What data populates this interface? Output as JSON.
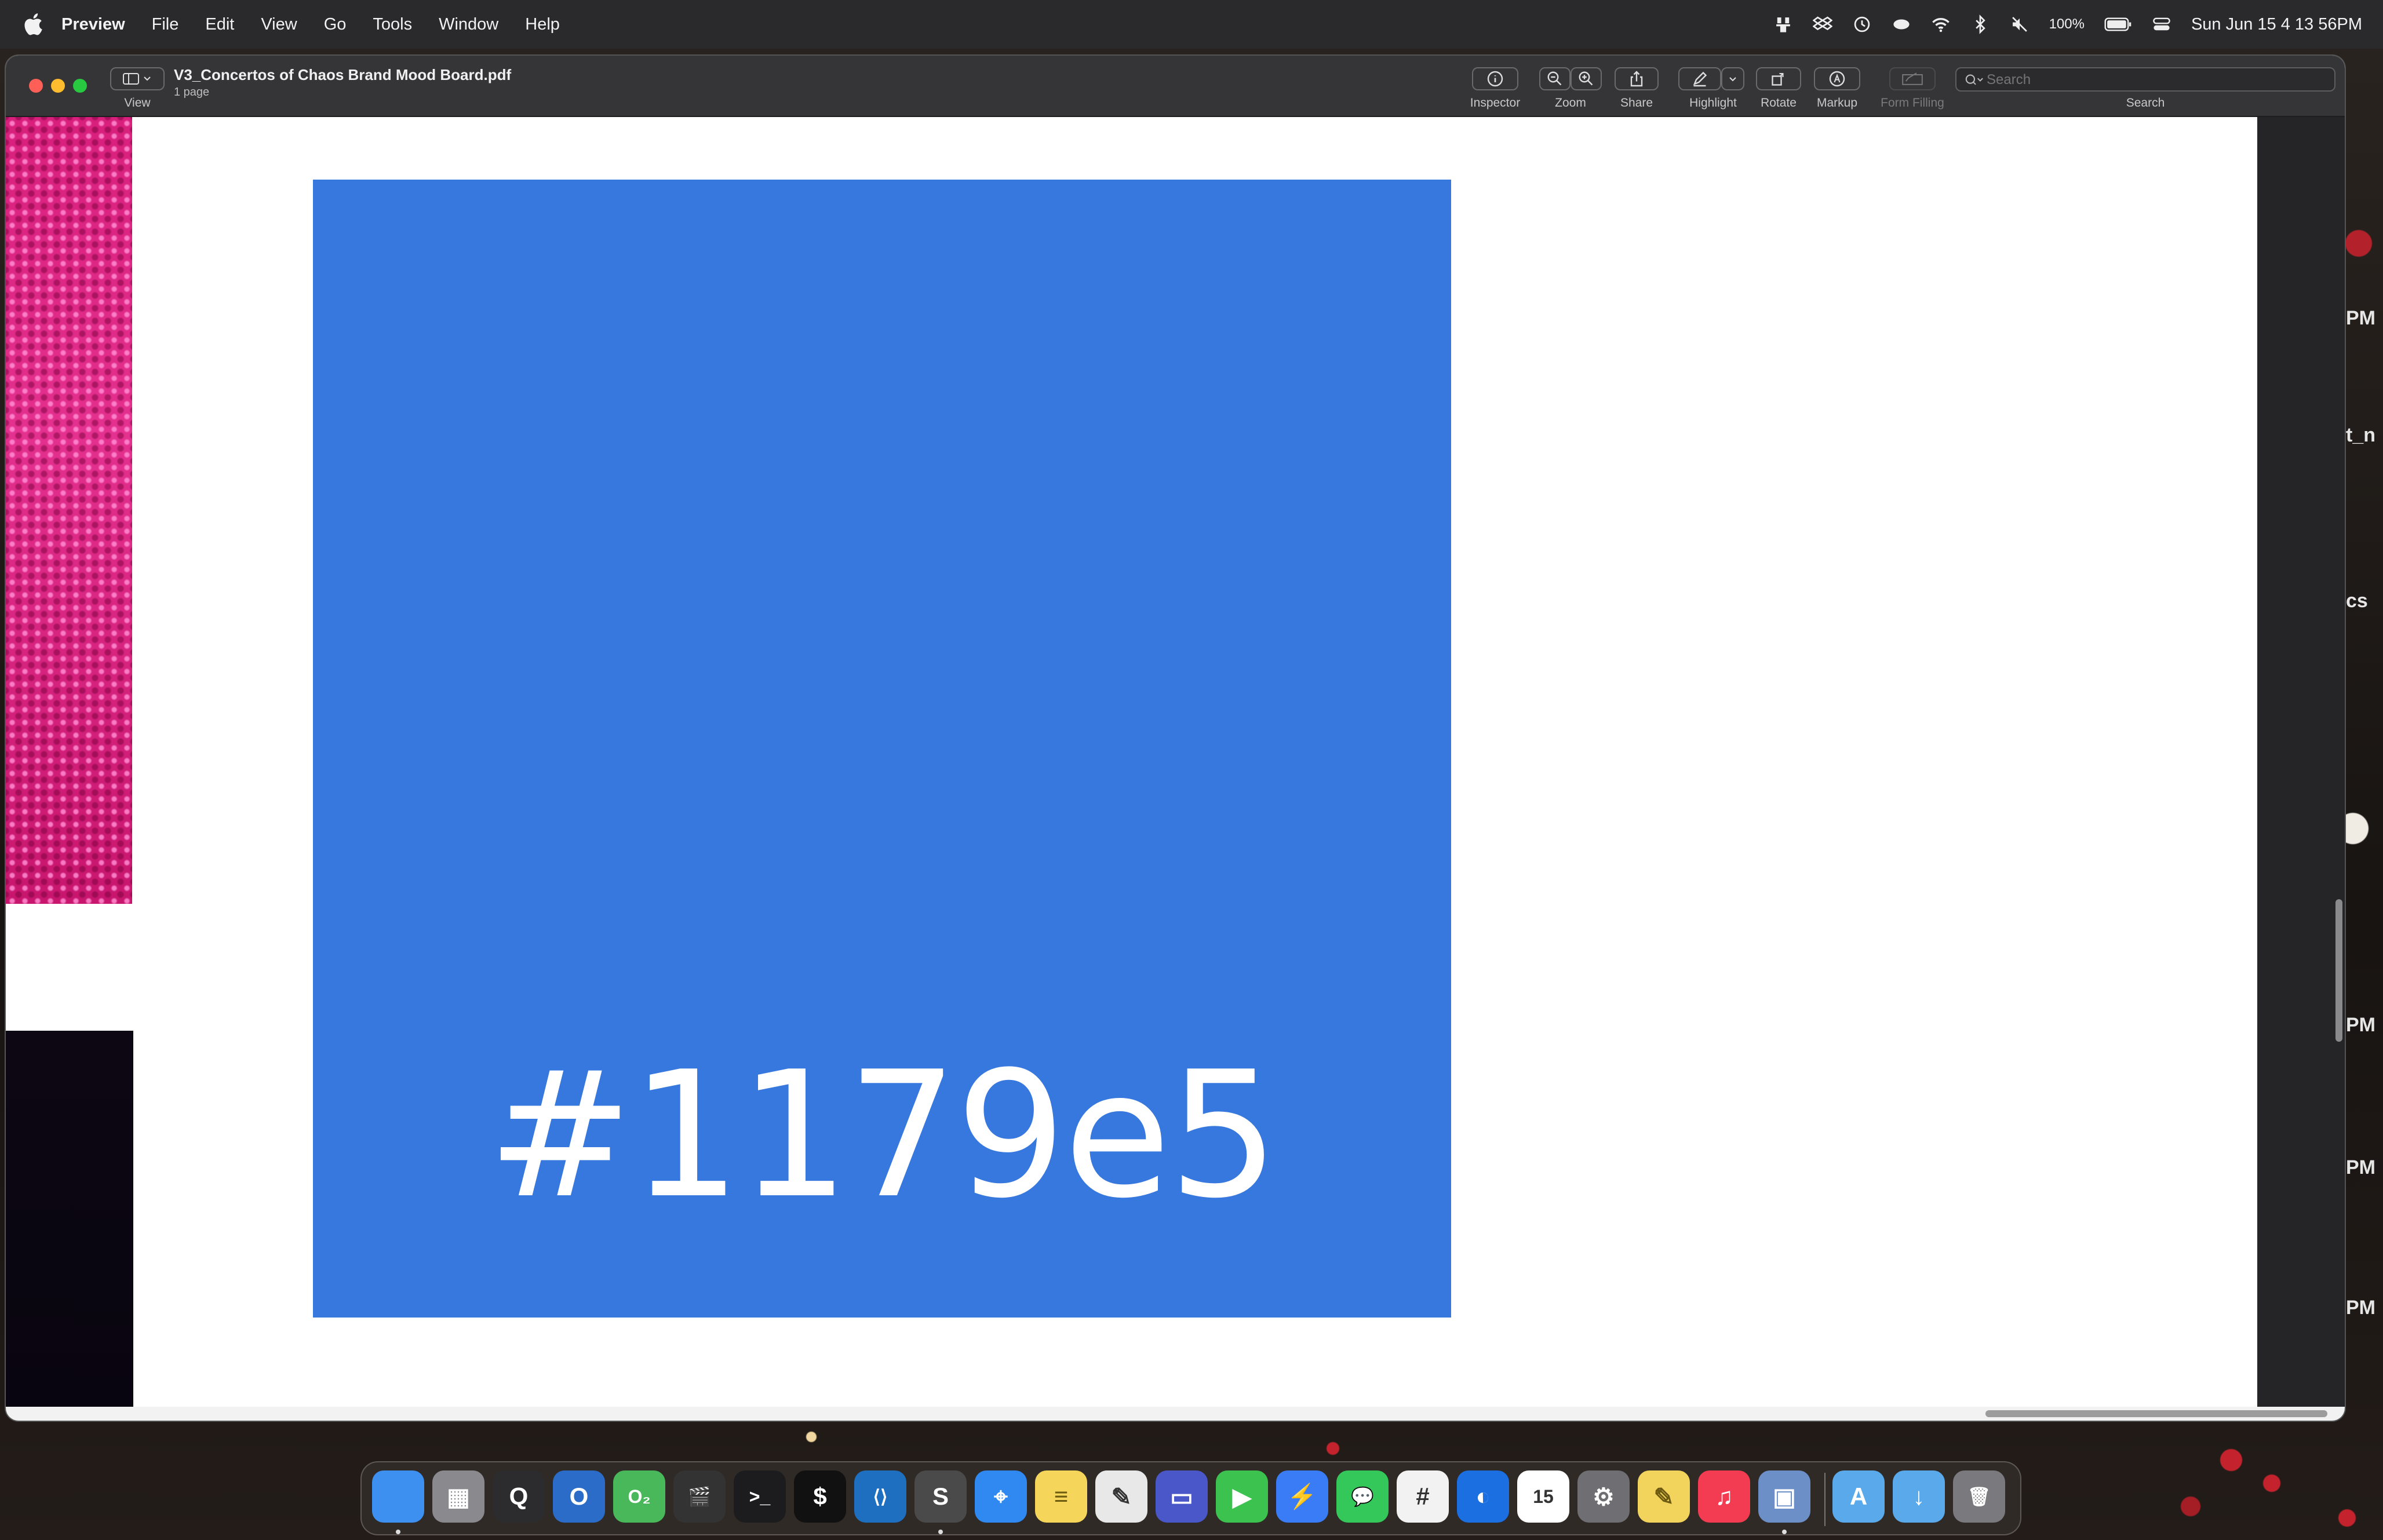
{
  "menubar": {
    "app_name": "Preview",
    "menus": [
      "File",
      "Edit",
      "View",
      "Go",
      "Tools",
      "Window",
      "Help"
    ],
    "status": {
      "battery_percent": "100%",
      "clock": "Sun Jun 15  4 13 56PM"
    },
    "status_icons": [
      "bartender-icon",
      "dropbox-icon",
      "time-machine-icon",
      "control-icon",
      "wifi-icon",
      "bluetooth-icon",
      "mute-icon",
      "battery-icon",
      "control-center-icon"
    ]
  },
  "window": {
    "title": "V3_Concertos of Chaos Brand Mood Board.pdf",
    "subtitle": "1 page",
    "toolbar": {
      "view_label": "View",
      "inspector_label": "Inspector",
      "zoom_label": "Zoom",
      "share_label": "Share",
      "highlight_label": "Highlight",
      "rotate_label": "Rotate",
      "markup_label": "Markup",
      "form_filling_label": "Form Filling",
      "search_label": "Search",
      "search_placeholder": "Search"
    }
  },
  "document": {
    "swatch_color": "#3778df",
    "swatch_hex_label": "#1179e5",
    "thumb_colors": {
      "pink": "#d81f7c",
      "dark": "#0c0712"
    }
  },
  "peek_text": [
    "PM",
    "t_n",
    "cs",
    "PM",
    "PM",
    "PM"
  ],
  "dock": {
    "apps": [
      {
        "name": "finder-icon",
        "color": "#3d8ff0",
        "glyph": ""
      },
      {
        "name": "launchpad-icon",
        "color": "#8a8a8e",
        "glyph": "▦"
      },
      {
        "name": "quicktime-icon",
        "color": "#2c2c2e",
        "glyph": "Q"
      },
      {
        "name": "oscar-icon",
        "color": "#2a6cc8",
        "glyph": "O"
      },
      {
        "name": "o2-chart-icon",
        "color": "#49b85a",
        "glyph": "O₂"
      },
      {
        "name": "claquette-icon",
        "color": "#333",
        "glyph": "🎬"
      },
      {
        "name": "terminal-icon",
        "color": "#1c1c1e",
        "glyph": ">_"
      },
      {
        "name": "terminal-alt-icon",
        "color": "#111",
        "glyph": "$"
      },
      {
        "name": "vscode-icon",
        "color": "#1f6fc0",
        "glyph": "⟨⟩"
      },
      {
        "name": "sublime-icon",
        "color": "#4a4a4a",
        "glyph": "S"
      },
      {
        "name": "safari-icon",
        "color": "#2f89f0",
        "glyph": "⌖"
      },
      {
        "name": "notes-icon",
        "color": "#f6d65a",
        "glyph": "≡"
      },
      {
        "name": "textedit-icon",
        "color": "#e8e8e8",
        "glyph": "✎"
      },
      {
        "name": "screens-icon",
        "color": "#4a57c9",
        "glyph": "▭"
      },
      {
        "name": "facetime-icon",
        "color": "#3cc24f",
        "glyph": "▶"
      },
      {
        "name": "messenger-icon",
        "color": "#3a7cf5",
        "glyph": "⚡"
      },
      {
        "name": "messages-icon",
        "color": "#34c759",
        "glyph": "💬"
      },
      {
        "name": "slack-icon",
        "color": "#f2f2f2",
        "glyph": "#"
      },
      {
        "name": "dashlane-icon",
        "color": "#1b6fe0",
        "glyph": "◐"
      },
      {
        "name": "calendar-icon",
        "color": "#ffffff",
        "glyph": "15"
      },
      {
        "name": "system-settings-icon",
        "color": "#6e6e73",
        "glyph": "⚙"
      },
      {
        "name": "stickies-icon",
        "color": "#f2d45c",
        "glyph": "✎"
      },
      {
        "name": "music-icon",
        "color": "#f33c51",
        "glyph": "♫"
      },
      {
        "name": "preview-icon",
        "color": "#6c8fc8",
        "glyph": "▣"
      },
      {
        "name": "applications-folder-icon",
        "color": "#5aa9ea",
        "glyph": "A"
      },
      {
        "name": "downloads-folder-icon",
        "color": "#5aa9ea",
        "glyph": "↓"
      },
      {
        "name": "trash-icon",
        "color": "#7a7a7e",
        "glyph": "🗑"
      }
    ]
  }
}
